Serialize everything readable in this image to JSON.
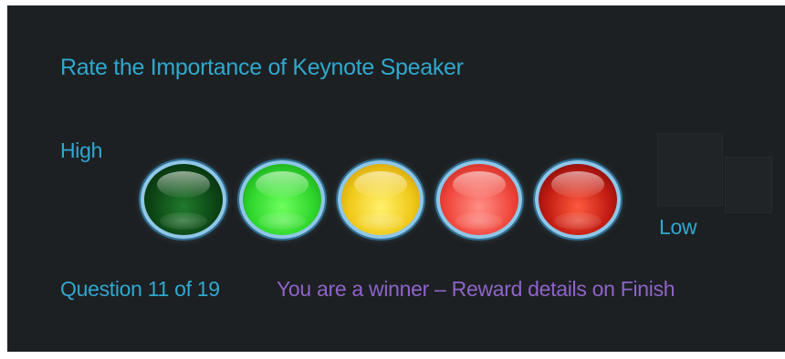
{
  "survey": {
    "title": "Rate the Importance of Keynote Speaker",
    "high_label": "High",
    "low_label": "Low",
    "question_counter": "Question 11 of 19",
    "reward_message": "You are a winner – Reward details on Finish"
  },
  "rating_scale": {
    "options": [
      {
        "name": "dark-green",
        "color": "#0d4515"
      },
      {
        "name": "bright-green",
        "color": "#2fd62c"
      },
      {
        "name": "yellow",
        "color": "#f0c91a"
      },
      {
        "name": "light-red",
        "color": "#f0473d"
      },
      {
        "name": "dark-red",
        "color": "#c11b12"
      }
    ],
    "ring_color": "#8fc7e8"
  },
  "colors": {
    "background": "#1d2022",
    "label_text": "#2fa8cf",
    "reward_text": "#8e63c9"
  }
}
